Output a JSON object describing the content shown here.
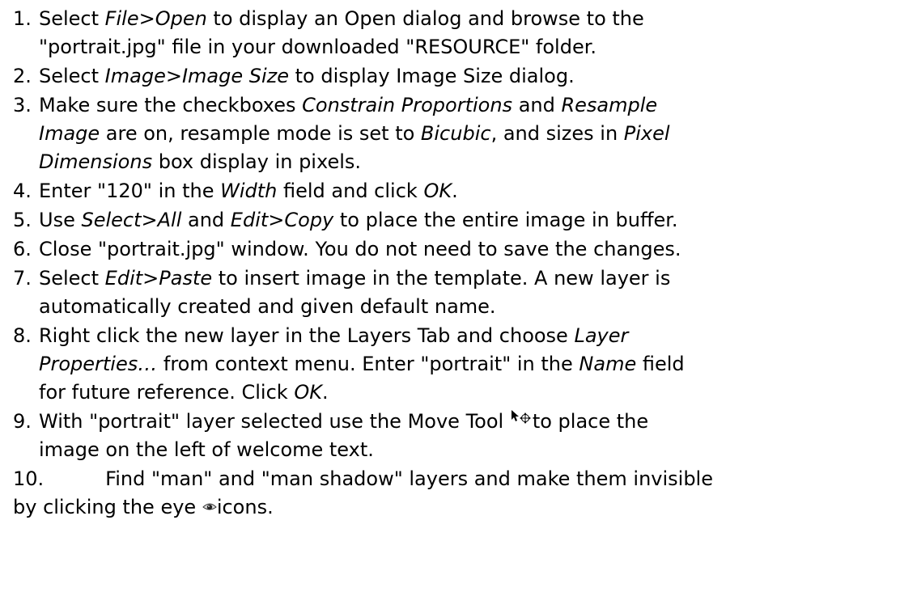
{
  "steps": [
    {
      "num": "1.",
      "parts": [
        {
          "t": "Select "
        },
        {
          "t": "File>Open",
          "i": true
        },
        {
          "t": " to display an Open dialog and browse to the"
        },
        {
          "br": true
        },
        {
          "t": "\"portrait.jpg\" file in your downloaded \"RESOURCE\" folder."
        }
      ]
    },
    {
      "num": "2.",
      "parts": [
        {
          "t": "Select "
        },
        {
          "t": "Image>Image Size",
          "i": true
        },
        {
          "t": " to display Image Size dialog."
        }
      ]
    },
    {
      "num": "3.",
      "parts": [
        {
          "t": "Make sure the checkboxes "
        },
        {
          "t": "Constrain Proportions",
          "i": true
        },
        {
          "t": " and "
        },
        {
          "t": "Resample",
          "i": true
        },
        {
          "br": true
        },
        {
          "t": "Image",
          "i": true
        },
        {
          "t": " are on, resample mode is set to "
        },
        {
          "t": "Bicubic",
          "i": true
        },
        {
          "t": ", and sizes in "
        },
        {
          "t": "Pixel",
          "i": true
        },
        {
          "br": true
        },
        {
          "t": "Dimensions",
          "i": true
        },
        {
          "t": " box display in pixels."
        }
      ]
    },
    {
      "num": "4.",
      "parts": [
        {
          "t": "Enter \"120\" in the "
        },
        {
          "t": "Width",
          "i": true
        },
        {
          "t": " field and click "
        },
        {
          "t": "OK",
          "i": true
        },
        {
          "t": "."
        }
      ]
    },
    {
      "num": "5.",
      "parts": [
        {
          "t": "Use "
        },
        {
          "t": "Select>All",
          "i": true
        },
        {
          "t": " and "
        },
        {
          "t": "Edit>Copy",
          "i": true
        },
        {
          "t": " to place the entire image in buffer."
        }
      ]
    },
    {
      "num": "6.",
      "parts": [
        {
          "t": "Close \"portrait.jpg\" window. You do not need to save the changes."
        }
      ]
    },
    {
      "num": "7.",
      "parts": [
        {
          "t": "Select "
        },
        {
          "t": "Edit>Paste",
          "i": true
        },
        {
          "t": " to insert image in the template. A new layer is"
        },
        {
          "br": true
        },
        {
          "t": "automatically created and given default name."
        }
      ]
    },
    {
      "num": "8.",
      "parts": [
        {
          "t": "Right click the new layer in the Layers Tab and choose "
        },
        {
          "t": "Layer",
          "i": true
        },
        {
          "br": true
        },
        {
          "t": "Properties…",
          "i": true
        },
        {
          "t": " from context menu. Enter \"portrait\" in the "
        },
        {
          "t": "Name",
          "i": true
        },
        {
          "t": " field"
        },
        {
          "br": true
        },
        {
          "t": "for future reference. Click "
        },
        {
          "t": "OK",
          "i": true
        },
        {
          "t": "."
        }
      ]
    },
    {
      "num": "9.",
      "parts": [
        {
          "t": "With \"portrait\" layer selected use the Move Tool "
        },
        {
          "icon": "move-tool-icon"
        },
        {
          "t": "to place the"
        },
        {
          "br": true
        },
        {
          "t": "image on the left of welcome text."
        }
      ]
    },
    {
      "num": "10.",
      "wide": true,
      "parts": [
        {
          "t": "Find \"man\" and \"man shadow\" layers and make them invisible"
        },
        {
          "br": true
        },
        {
          "t": "by clicking the eye "
        },
        {
          "icon": "eye-icon"
        },
        {
          "t": "icons."
        }
      ]
    }
  ]
}
